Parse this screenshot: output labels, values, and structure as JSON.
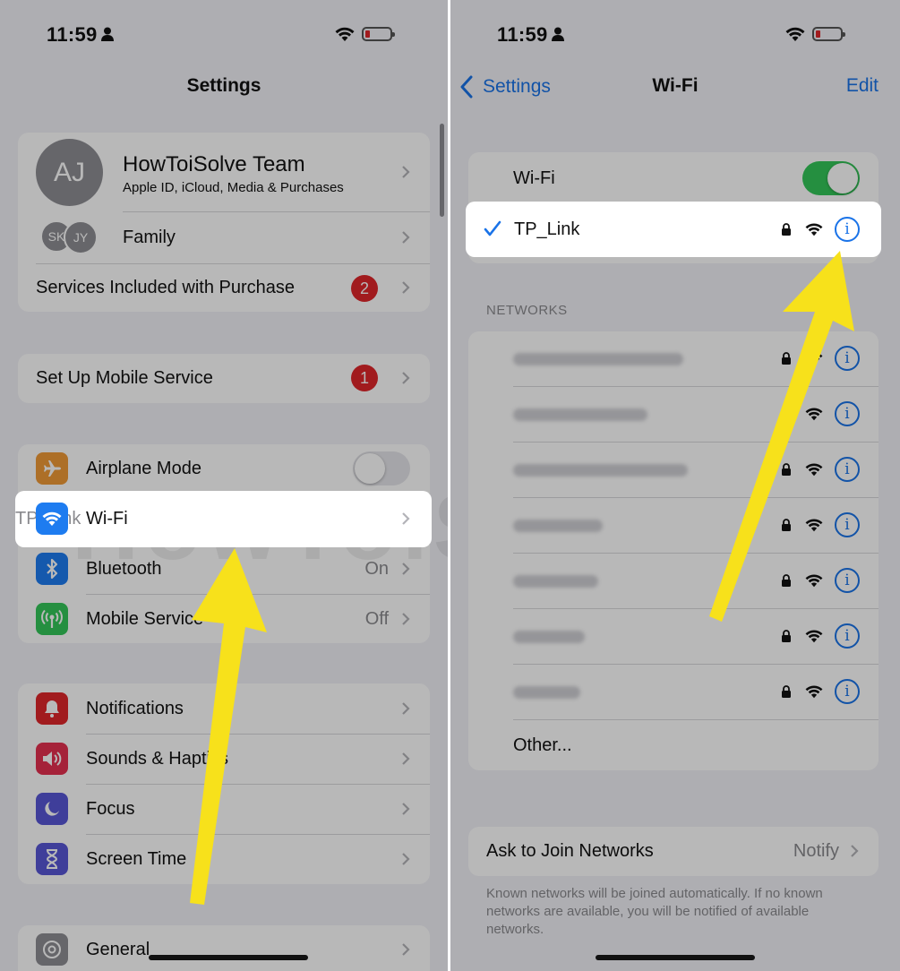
{
  "left": {
    "status": {
      "time": "11:59"
    },
    "title": "Settings",
    "profile": {
      "initials": "AJ",
      "name": "HowToiSolve Team",
      "subtitle": "Apple ID, iCloud, Media & Purchases"
    },
    "family": {
      "avatar1": "SK",
      "avatar2": "JY",
      "label": "Family"
    },
    "services": {
      "label": "Services Included with Purchase",
      "badge": "2"
    },
    "mobile_setup": {
      "label": "Set Up Mobile Service",
      "badge": "1"
    },
    "connectivity": [
      {
        "label": "Airplane Mode",
        "value": ""
      },
      {
        "label": "Wi-Fi",
        "value": "TP_Link"
      },
      {
        "label": "Bluetooth",
        "value": "On"
      },
      {
        "label": "Mobile Service",
        "value": "Off"
      }
    ],
    "system": [
      {
        "label": "Notifications"
      },
      {
        "label": "Sounds & Haptics"
      },
      {
        "label": "Focus"
      },
      {
        "label": "Screen Time"
      }
    ],
    "general": {
      "label": "General"
    }
  },
  "right": {
    "status": {
      "time": "11:59"
    },
    "back": "Settings",
    "title": "Wi-Fi",
    "edit": "Edit",
    "wifi_toggle": {
      "label": "Wi-Fi",
      "on": true
    },
    "connected": {
      "name": "TP_Link"
    },
    "networks_header": "NETWORKS",
    "other": "Other...",
    "ask_join": {
      "label": "Ask to Join Networks",
      "value": "Notify"
    },
    "footer": "Known networks will be joined automatically. If no known networks are available, you will be notified of available networks."
  },
  "colors": {
    "accent": "#1a73e8",
    "toggle_on": "#34c759",
    "badge_red": "#e0262a",
    "arrow_yellow": "#f7e11b",
    "wifi_icon_bg": "#1e7cf0"
  },
  "watermark": "HowToiSolve.com"
}
